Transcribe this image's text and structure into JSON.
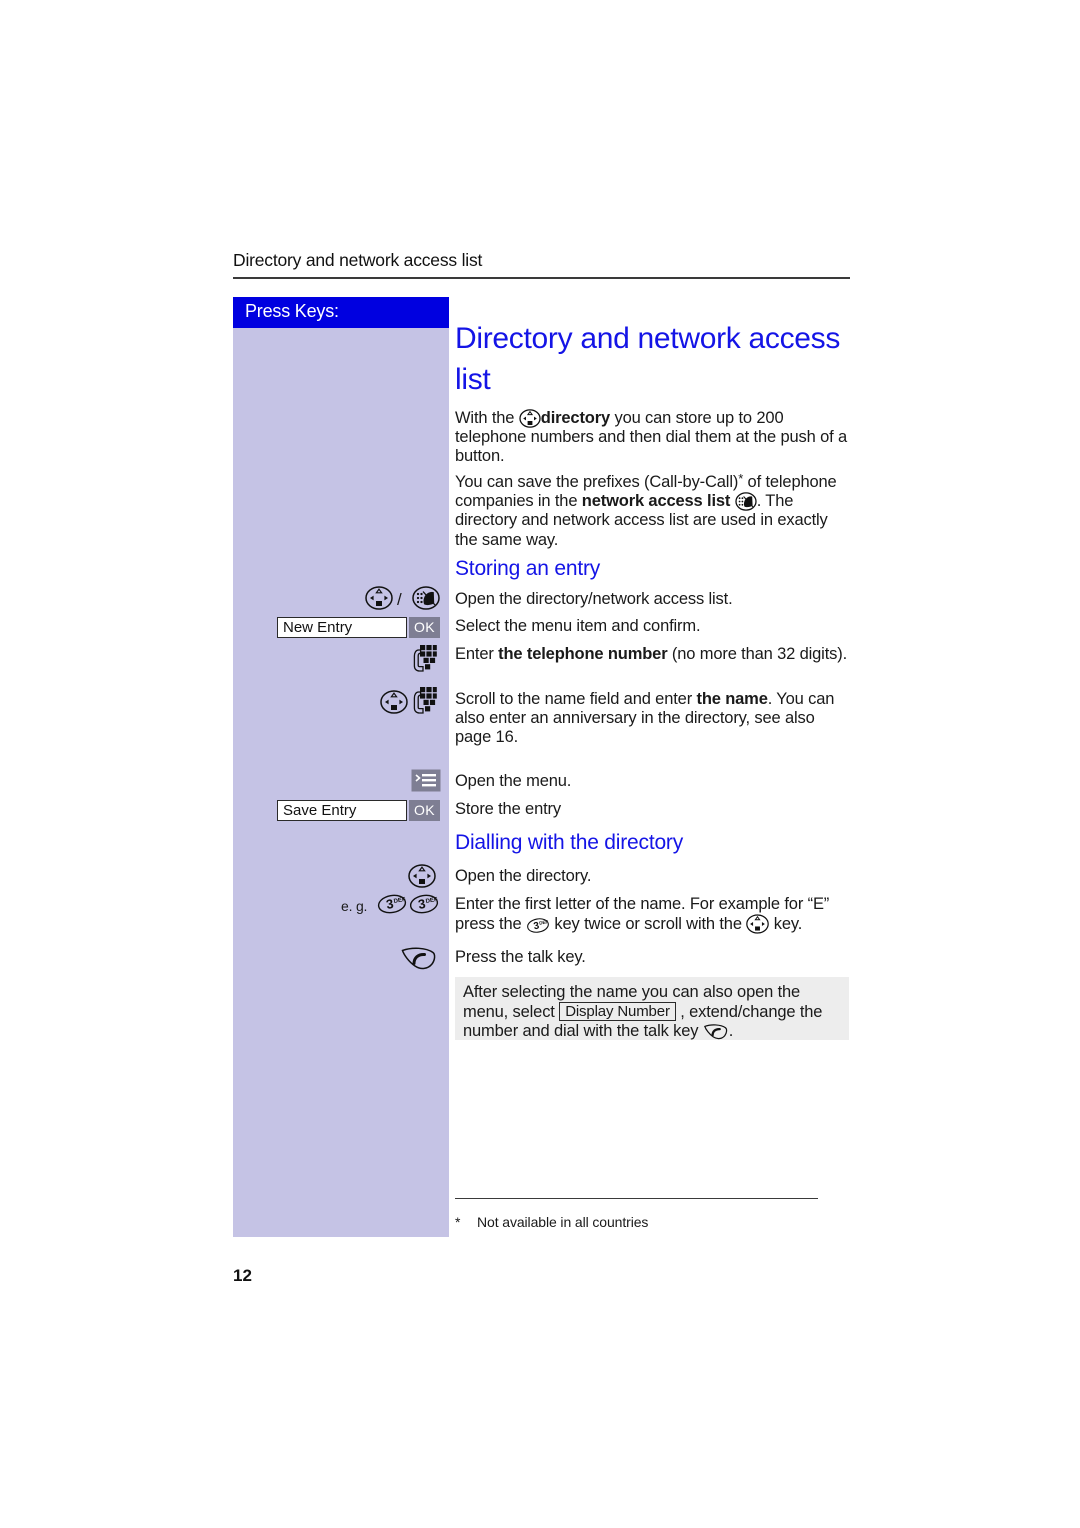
{
  "document": {
    "running_header": "Directory and network access list",
    "page_number": "12"
  },
  "sidebar": {
    "band_label": "Press Keys:",
    "band_color": "#0000E0",
    "panel_color": "#C5C3E5"
  },
  "main": {
    "heading": "Directory and network access list",
    "heading_color": "#1414E6",
    "intro": {
      "p1_before": "With the ",
      "p1_bold": "directory",
      "p1_after": " you can store up to 200 telephone numbers and then dial them at the push of a button.",
      "p2_a": "You can save the prefixes (Call-by-Call)",
      "p2_star": "*",
      "p2_b": " of telephone companies in the ",
      "p2_bold": "network access list",
      "p2_c": ". The directory and network access list are used in exactly the same way."
    },
    "sections": [
      {
        "title": "Storing an entry",
        "steps": [
          {
            "key_icons": [
              "nav-key-icon",
              "slash",
              "network-access-icon"
            ],
            "text": "Open the directory/network access list."
          },
          {
            "softkey_label": "New Entry",
            "ok_label": "OK",
            "text": "Select the menu item and confirm."
          },
          {
            "key_icons": [
              "keypad-icon"
            ],
            "text_before": "Enter ",
            "text_bold": "the telephone number",
            "text_after": " (no more than 32 digits)."
          },
          {
            "key_icons": [
              "nav-key-icon",
              "keypad-icon"
            ],
            "text_before": "Scroll to the name field and enter ",
            "text_bold": "the name",
            "text_after": ". You can also enter an anniversary in the directory, see also page 16."
          },
          {
            "key_icons": [
              "menu-key-icon"
            ],
            "text": "Open the menu."
          },
          {
            "softkey_label": "Save Entry",
            "ok_label": "OK",
            "text": "Store the entry"
          }
        ]
      },
      {
        "title": "Dialling with the directory",
        "steps": [
          {
            "key_icons": [
              "nav-key-icon"
            ],
            "text": "Open the directory."
          },
          {
            "eg_label": "e. g.",
            "key_icons": [
              "digit-3-key",
              "digit-3-key"
            ],
            "text_a": "Enter the first letter of the name. For example for “E” press the ",
            "text_b": " key twice or scroll with the ",
            "text_c": " key."
          },
          {
            "key_icons": [
              "talk-key-icon"
            ],
            "text": "Press the talk key."
          }
        ]
      }
    ],
    "note": {
      "a": "After selecting the name you can also open the menu, select ",
      "box_label": "Display Number",
      "b": " , extend/change the number and dial with the talk key ",
      "c": "."
    },
    "footnote": {
      "mark": "*",
      "text": "Not available in all countries"
    }
  },
  "key_labels": {
    "digit": "3",
    "digit_letters": "DEF"
  }
}
